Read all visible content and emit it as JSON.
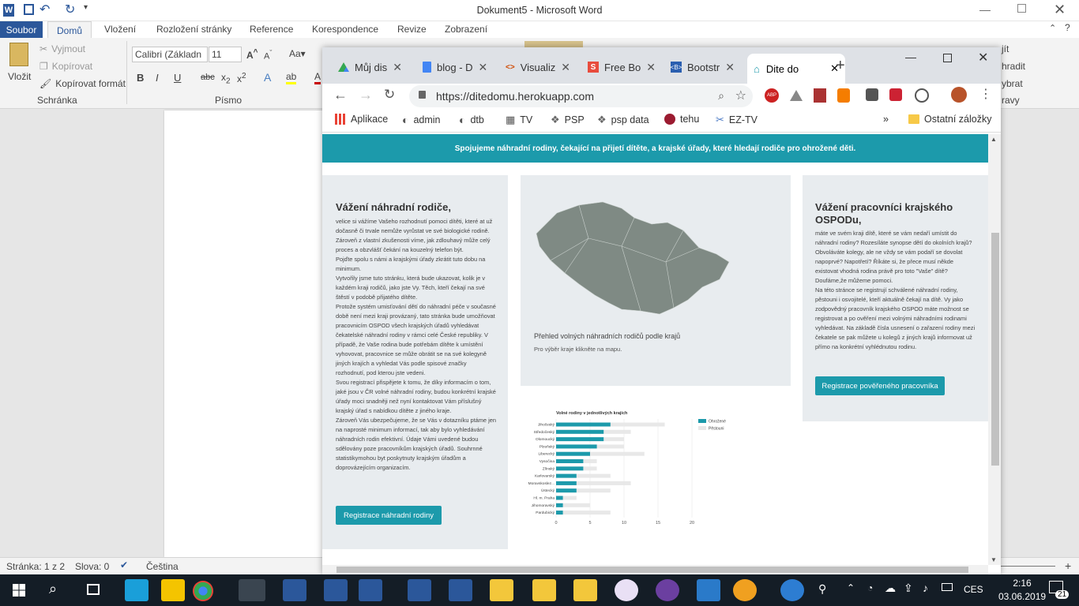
{
  "word": {
    "title": "Dokument5  -  Microsoft Word",
    "tabs": [
      "Soubor",
      "Domů",
      "Vložení",
      "Rozložení stránky",
      "Reference",
      "Korespondence",
      "Revize",
      "Zobrazení"
    ],
    "clipboard": {
      "paste": "Vložit",
      "cut": "Vyjmout",
      "copy": "Kopírovat",
      "format": "Kopírovat formát",
      "group": "Schránka"
    },
    "font": {
      "name": "Calibri (Základn",
      "size": "11",
      "group": "Písmo"
    },
    "right_fragments": [
      "jít",
      "hradit",
      "ybrat",
      "ravy"
    ],
    "status": {
      "page": "Stránka: 1 z 2",
      "words": "Slova: 0",
      "lang": "Čeština"
    }
  },
  "chrome": {
    "tabs": [
      {
        "label": "Můj dis",
        "icon": "google-drive-icon"
      },
      {
        "label": "blog - D",
        "icon": "google-docs-icon"
      },
      {
        "label": "Visualiz",
        "icon": "code-icon"
      },
      {
        "label": "Free Bo",
        "icon": "s-icon"
      },
      {
        "label": "Bootstr",
        "icon": "bootstrap-icon"
      },
      {
        "label": "Dite do",
        "icon": "site-icon"
      }
    ],
    "url": "https://ditedomu.herokuapp.com",
    "bookmarks": [
      "Aplikace",
      "admin",
      "dtb",
      "TV",
      "PSP",
      "psp data",
      "tehu",
      "EZ-TV"
    ],
    "other_bookmarks": "Ostatní záložky"
  },
  "site": {
    "banner": "Spojujeme náhradní rodiny, čekající na přijetí dítěte, a krajské úřady, které hledají rodiče pro ohrožené děti.",
    "left": {
      "title": "Vážení náhradní rodiče,",
      "paragraphs": [
        "velice si vážíme Vašeho rozhodnutí pomoci dítěti, které at už dočasně či trvale nemůže vyrůstat ve své biologické rodině. Zároveň z vlastní zkušenosti víme, jak zdlouhavý může celý proces a obzvlášť čekání na kouzelný telefon být.",
        "Pojďte spolu s námi a krajskými úřady zkrátit tuto dobu na minimum.",
        "Vytvořily jsme tuto stránku, která bude ukazovat, kolik je v každém kraji rodičů, jako jste Vy. Těch, kteří čekají na své štěstí v podobě přijatého dítěte.",
        "Protože systém umisťování dětí do náhradní péče v současné době není mezi kraji provázaný, tato stránka bude umožňovat pracovnicím OSPOD všech krajských úřadů vyhledávat čekatelské náhradní rodiny v rámci celé České republiky. V případě, že Vaše rodina bude potřebám dítěte k umístění vyhovovat, pracovnice se může obrátit se na své kolegyně jiných krajích a vyhledat Vás podle spisové značky rozhodnutí, pod kterou jste vedeni.",
        "Svou registrací přispějete k tomu, že díky informacím o tom, jaké jsou v ČR volné náhradní rodiny, budou konkrétní krajské úřady moci snadněji než nyní kontaktovat Vám příslušný krajský úřad s nabídkou dítěte z jiného kraje.",
        "Zároveň Vás ubezpečujeme, že se Vás v dotazníku ptáme jen na naprosté minimum informací, tak aby bylo vyhledávání náhradních rodin efektivní. Údaje Vámi uvedené budou sdělovány poze pracovníkům krajských úřadů. Souhrnné statistikymohou byt poskytnuty krajským úřadům a doprovázejícím organizacím."
      ],
      "button": "Registrace náhradní rodiny"
    },
    "map": {
      "caption": "Přehled volných náhradních rodičů podle krajů",
      "hint": "Pro výběr kraje klikněte na mapu."
    },
    "right": {
      "title": "Vážení pracovníci krajského OSPODu,",
      "paragraphs": [
        "máte ve svém kraji dítě, které se vám nedaří umístit do náhradní rodiny? Rozesíláte synopse dětí do okolních krajů? Obvoláváte kolegy, ale ne vždy se vám podaří se dovolat napoprvé? Napotřetí? Říkáte si, že přece musí někde existovat vhodná rodina právě pro toto \"Vaše\" dítě?",
        "Doufáme,že můžeme pomoci.",
        "Na této stránce se registrují schválené náhradní rodiny, pěstouni i osvojitelé, kteří aktuálně čekají na dítě. Vy jako zodpovědný pracovník krajského OSPOD máte možnost se registrovat a po ověření mezi volnými náhradními rodinami vyhledávat. Na základě čísla usnesení o zařazení rodiny mezi čekatele se pak můžete u kolegů z jiných krajů informovat už přímo na konkrétní vyhlédnutou rodinu."
      ],
      "button": "Registrace pověřeného pracovníka"
    }
  },
  "chart_data": {
    "type": "bar",
    "title": "Volné rodiny v jednotlivých krajích",
    "categories": [
      "Jihočeský",
      "Středočeský",
      "Olomoucký",
      "Plzeňský",
      "Liberecký",
      "Vysočina",
      "Zlínský",
      "Karlovarský",
      "Moravskoslez...",
      "Ústecký",
      "Hl. m. Praha",
      "Jihomoravský",
      "Pardubický"
    ],
    "series": [
      {
        "name": "Ohrožené",
        "color": "#1c9aab",
        "values": [
          8,
          7,
          7,
          6,
          5,
          4,
          4,
          3,
          3,
          3,
          1,
          1,
          1
        ]
      },
      {
        "name": "Pěstouni",
        "color": "#e8e8e8",
        "values": [
          16,
          11,
          10,
          10,
          13,
          6,
          6,
          8,
          11,
          8,
          3,
          5,
          8
        ]
      }
    ],
    "xticks": [
      0,
      5,
      10,
      15,
      20
    ],
    "xlim": [
      0,
      20
    ],
    "legend": "top-right"
  },
  "taskbar": {
    "time": "2:16",
    "date": "03.06.2019",
    "lang": "CES",
    "notif": "21"
  }
}
